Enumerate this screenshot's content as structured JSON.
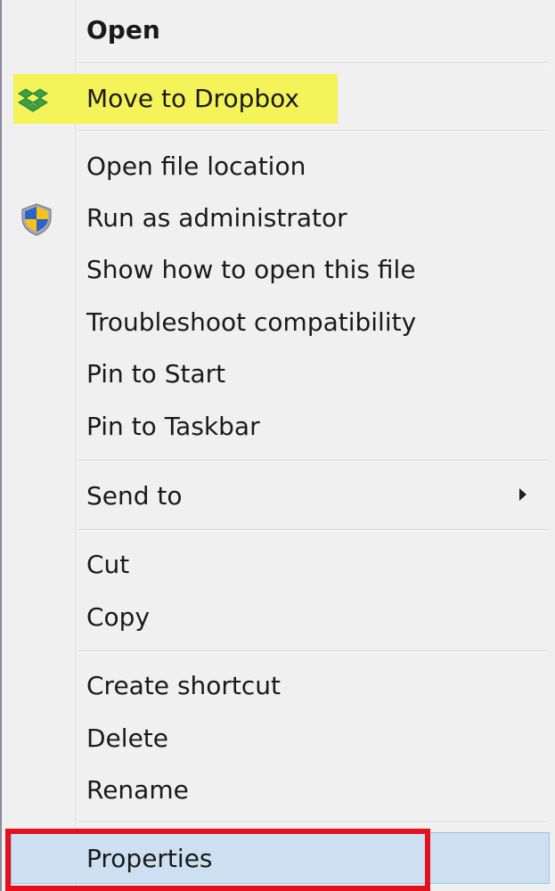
{
  "menu": {
    "items": [
      {
        "label": "Open"
      },
      {
        "label": "Move to Dropbox"
      },
      {
        "label": "Open file location"
      },
      {
        "label": "Run as administrator"
      },
      {
        "label": "Show how to open this file"
      },
      {
        "label": "Troubleshoot compatibility"
      },
      {
        "label": "Pin to Start"
      },
      {
        "label": "Pin to Taskbar"
      },
      {
        "label": "Send to"
      },
      {
        "label": "Cut"
      },
      {
        "label": "Copy"
      },
      {
        "label": "Create shortcut"
      },
      {
        "label": "Delete"
      },
      {
        "label": "Rename"
      },
      {
        "label": "Properties"
      }
    ]
  },
  "icons": {
    "dropbox": "dropbox-icon",
    "uac_shield": "uac-shield-icon",
    "submenu_arrow": "chevron-right-icon"
  },
  "colors": {
    "highlight": "#f4f45a",
    "hover": "#cde0f2",
    "annotation_frame": "#e3101e",
    "menu_background": "#f0f0f0"
  }
}
